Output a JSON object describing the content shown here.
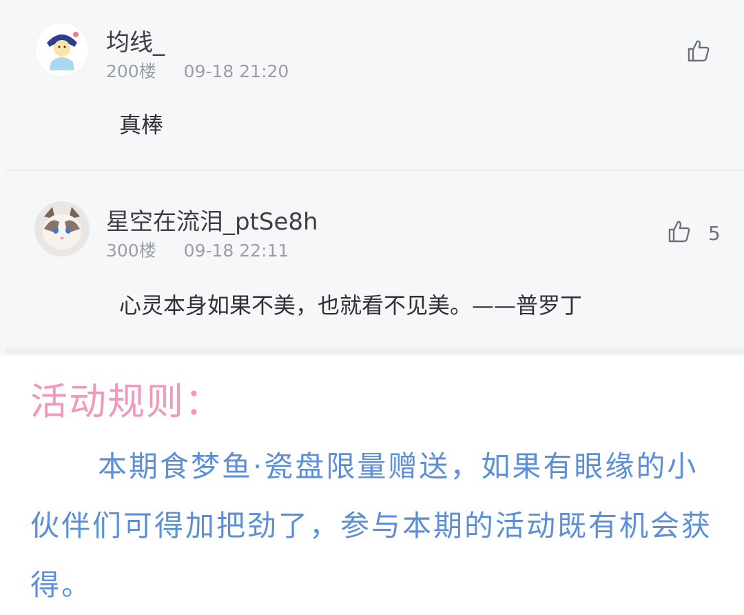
{
  "comments": [
    {
      "username": "均线_",
      "floor": "200楼",
      "time": "09-18 21:20",
      "text": "真棒",
      "like_icon": "thumbs-up-icon",
      "like_count": ""
    },
    {
      "username": "星空在流泪_ptSe8h",
      "floor": "300楼",
      "time": "09-18 22:11",
      "text": "心灵本身如果不美，也就看不见美。——普罗丁",
      "like_icon": "thumbs-up-icon",
      "like_count": "5"
    }
  ],
  "rules": {
    "title": "活动规则：",
    "body": "本期食梦鱼·瓷盘限量赠送，如果有眼缘的小伙伴们可得加把劲了，参与本期的活动既有机会获得。"
  },
  "colors": {
    "title_pink": "#f09ab9",
    "body_blue": "#5b8fd9",
    "card_bg": "#f6f7f9"
  }
}
